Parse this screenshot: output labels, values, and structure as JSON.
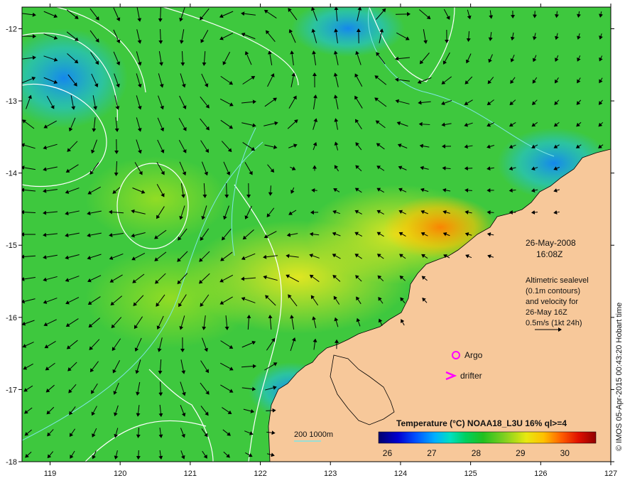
{
  "map": {
    "x_ticks": [
      "119",
      "120",
      "121",
      "122",
      "123",
      "124",
      "125",
      "126",
      "127"
    ],
    "y_ticks": [
      "-12",
      "-13",
      "-14",
      "-15",
      "-16",
      "-17",
      "-18"
    ],
    "lon_range": [
      118.6,
      127.0
    ],
    "lat_range": [
      -18.0,
      -11.7
    ]
  },
  "annotation": {
    "date": "26-May-2008",
    "time": "16:08Z",
    "info_lines": [
      "Altimetric sealevel",
      "(0.1m contours)",
      "and velocity for",
      "26-May 16Z",
      "0.5m/s (1kt 24h)"
    ]
  },
  "legend": {
    "argo": "Argo",
    "drifter": "drifter",
    "depth": "200  1000m",
    "colorbar_title": "Temperature (°C) NOAA18_L3U 16% ql>=4",
    "colorbar_ticks": [
      "26",
      "27",
      "28",
      "29",
      "30"
    ],
    "colorbar_range": [
      25.8,
      30.7
    ],
    "colorbar_stops": [
      "#00006e",
      "#0000d0",
      "#0050ff",
      "#00b0ff",
      "#00e0c0",
      "#00d060",
      "#20c020",
      "#80d020",
      "#e8e810",
      "#ffc000",
      "#ff6000",
      "#e01000",
      "#900000"
    ]
  },
  "credit": "© IMOS 05-Apr-2015 00:43:20 Hobart time",
  "colors": {
    "land": "#f7c89a",
    "ocean": "#3ec83e",
    "warm": "#d4e020",
    "cool": "#20b0e0",
    "contour": "#ffffff",
    "isobath": "#7fe6e6",
    "argo": "#ff00ff",
    "drifter": "#ff00ff",
    "arrow": "#000000"
  }
}
